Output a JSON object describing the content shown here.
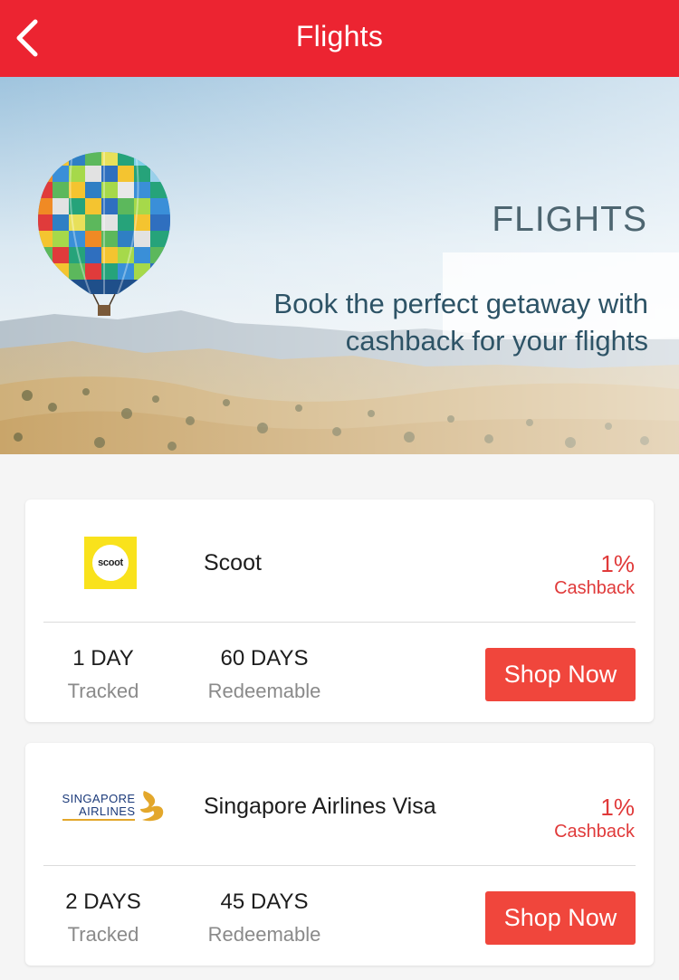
{
  "header": {
    "title": "Flights"
  },
  "hero": {
    "badge": "FLIGHTS",
    "tagline": "Book the perfect getaway with cashback for your flights"
  },
  "merchants": [
    {
      "name": "Scoot",
      "logo_text": "scoot",
      "rate": "1%",
      "rate_label": "Cashback",
      "tracked_value": "1 DAY",
      "tracked_label": "Tracked",
      "redeemable_value": "60 DAYS",
      "redeemable_label": "Redeemable",
      "button": "Shop Now"
    },
    {
      "name": "Singapore Airlines Visa",
      "logo_line1": "SINGAPORE",
      "logo_line2": "AIRLINES",
      "rate": "1%",
      "rate_label": "Cashback",
      "tracked_value": "2 DAYS",
      "tracked_label": "Tracked",
      "redeemable_value": "45 DAYS",
      "redeemable_label": "Redeemable",
      "button": "Shop Now"
    }
  ],
  "colors": {
    "brand_red": "#ec2431",
    "button_red": "#f0463c",
    "scoot_yellow": "#f9e21c",
    "sia_blue": "#1b3a7a",
    "sia_gold": "#e3a72b"
  },
  "icons": {
    "back": "chevron-left-icon",
    "balloon": "hot-air-balloon-illustration"
  }
}
